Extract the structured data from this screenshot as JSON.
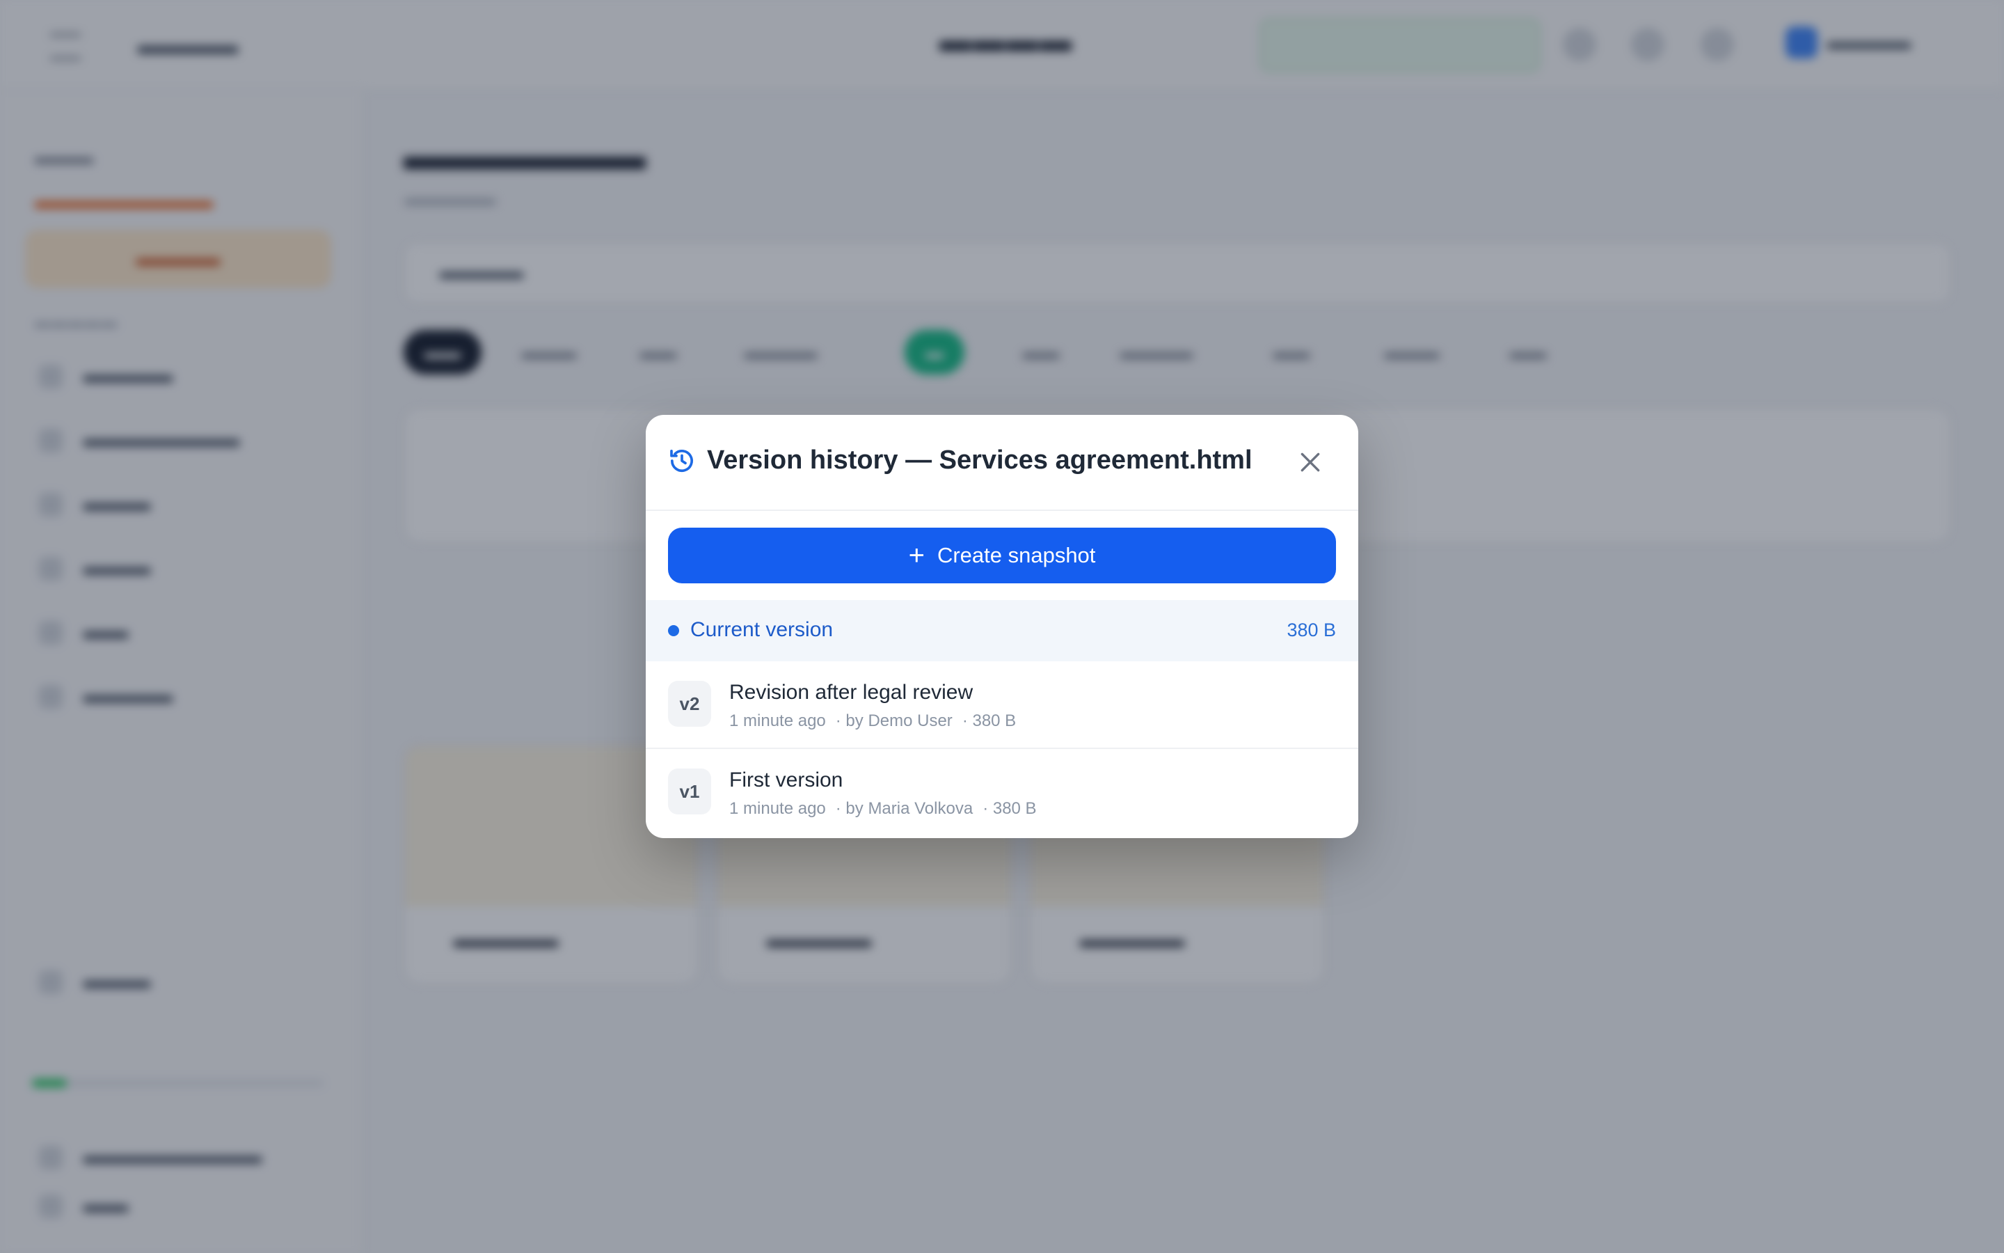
{
  "dialog": {
    "title": "Version history — Services agreement.html",
    "create_label": "Create snapshot",
    "current": {
      "label": "Current version",
      "size": "380 B"
    },
    "versions": [
      {
        "badge": "v2",
        "name": "Revision after legal review",
        "time": "1 minute ago",
        "author": "· by Demo User",
        "size": "· 380 B"
      },
      {
        "badge": "v1",
        "name": "First version",
        "time": "1 minute ago",
        "author": "· by Maria Volkova",
        "size": "· 380 B"
      }
    ]
  },
  "colors": {
    "accent": "#155eef",
    "current_row_bg": "#f2f6fb",
    "overlay": "rgba(30,41,59,0.42)"
  },
  "icons": {
    "history": "history-icon",
    "close": "close-icon",
    "plus": "plus-icon"
  }
}
